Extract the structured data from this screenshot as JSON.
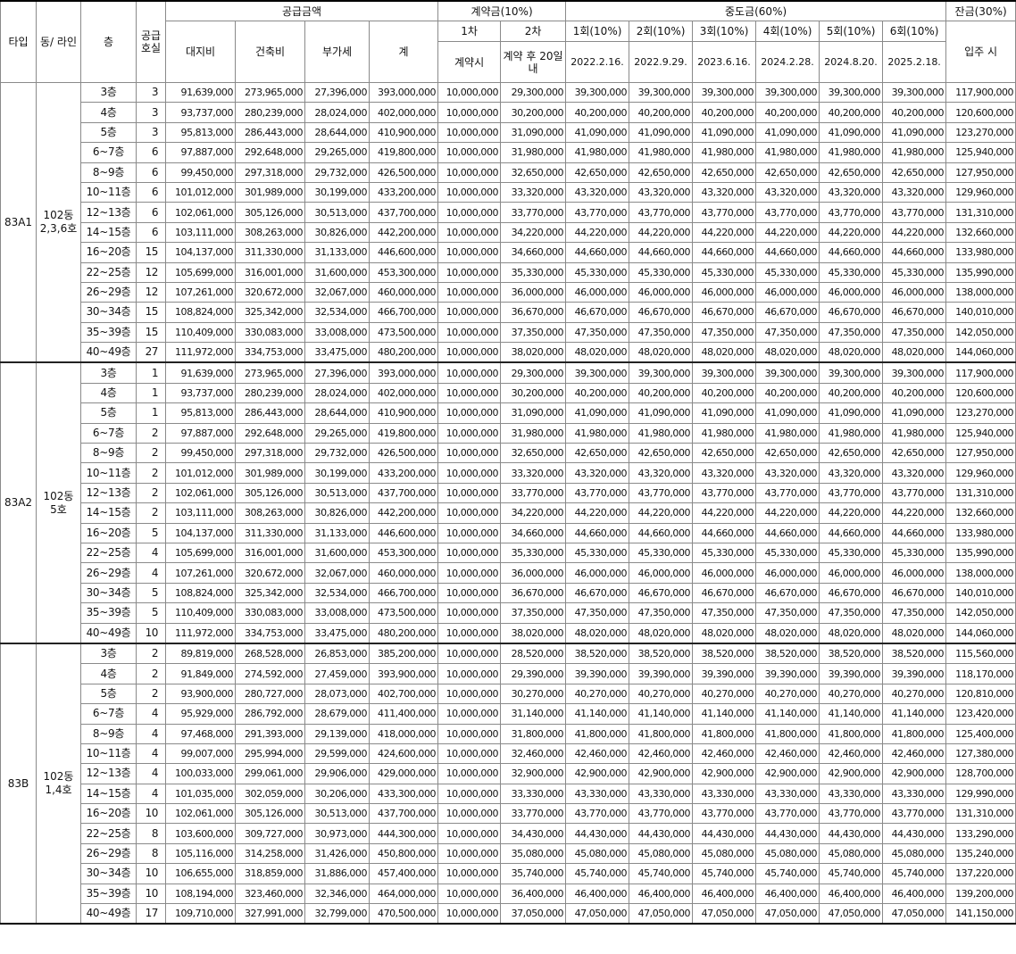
{
  "headers": {
    "type": "타입",
    "dong_line": "동/ 라인",
    "floor": "층",
    "supply_units": "공급 호실",
    "supply_amount": "공급금액",
    "land": "대지비",
    "building": "건축비",
    "vat": "부가세",
    "total": "계",
    "deposit": "계약금(10%)",
    "deposit_1": "1차",
    "deposit_2": "2차",
    "deposit_1_when": "계약시",
    "deposit_2_when": "계약 후 20일내",
    "middle": "중도금(60%)",
    "middle_rounds": [
      "1회(10%)",
      "2회(10%)",
      "3회(10%)",
      "4회(10%)",
      "5회(10%)",
      "6회(10%)"
    ],
    "middle_dates": [
      "2022.2.16.",
      "2022.9.29.",
      "2023.6.16.",
      "2024.2.28.",
      "2024.8.20.",
      "2025.2.18."
    ],
    "balance": "잔금(30%)",
    "balance_when": "입주 시"
  },
  "groups": [
    {
      "type": "83A1",
      "dong": "102동",
      "line": "2,3,6호",
      "rows": [
        {
          "floor": "3층",
          "units": "3",
          "land": "91,639,000",
          "building": "273,965,000",
          "vat": "27,396,000",
          "total": "393,000,000",
          "dep1": "10,000,000",
          "dep2": "29,300,000",
          "mid": "39,300,000",
          "bal": "117,900,000"
        },
        {
          "floor": "4층",
          "units": "3",
          "land": "93,737,000",
          "building": "280,239,000",
          "vat": "28,024,000",
          "total": "402,000,000",
          "dep1": "10,000,000",
          "dep2": "30,200,000",
          "mid": "40,200,000",
          "bal": "120,600,000"
        },
        {
          "floor": "5층",
          "units": "3",
          "land": "95,813,000",
          "building": "286,443,000",
          "vat": "28,644,000",
          "total": "410,900,000",
          "dep1": "10,000,000",
          "dep2": "31,090,000",
          "mid": "41,090,000",
          "bal": "123,270,000"
        },
        {
          "floor": "6~7층",
          "units": "6",
          "land": "97,887,000",
          "building": "292,648,000",
          "vat": "29,265,000",
          "total": "419,800,000",
          "dep1": "10,000,000",
          "dep2": "31,980,000",
          "mid": "41,980,000",
          "bal": "125,940,000"
        },
        {
          "floor": "8~9층",
          "units": "6",
          "land": "99,450,000",
          "building": "297,318,000",
          "vat": "29,732,000",
          "total": "426,500,000",
          "dep1": "10,000,000",
          "dep2": "32,650,000",
          "mid": "42,650,000",
          "bal": "127,950,000"
        },
        {
          "floor": "10~11층",
          "units": "6",
          "land": "101,012,000",
          "building": "301,989,000",
          "vat": "30,199,000",
          "total": "433,200,000",
          "dep1": "10,000,000",
          "dep2": "33,320,000",
          "mid": "43,320,000",
          "bal": "129,960,000"
        },
        {
          "floor": "12~13층",
          "units": "6",
          "land": "102,061,000",
          "building": "305,126,000",
          "vat": "30,513,000",
          "total": "437,700,000",
          "dep1": "10,000,000",
          "dep2": "33,770,000",
          "mid": "43,770,000",
          "bal": "131,310,000"
        },
        {
          "floor": "14~15층",
          "units": "6",
          "land": "103,111,000",
          "building": "308,263,000",
          "vat": "30,826,000",
          "total": "442,200,000",
          "dep1": "10,000,000",
          "dep2": "34,220,000",
          "mid": "44,220,000",
          "bal": "132,660,000"
        },
        {
          "floor": "16~20층",
          "units": "15",
          "land": "104,137,000",
          "building": "311,330,000",
          "vat": "31,133,000",
          "total": "446,600,000",
          "dep1": "10,000,000",
          "dep2": "34,660,000",
          "mid": "44,660,000",
          "bal": "133,980,000"
        },
        {
          "floor": "22~25층",
          "units": "12",
          "land": "105,699,000",
          "building": "316,001,000",
          "vat": "31,600,000",
          "total": "453,300,000",
          "dep1": "10,000,000",
          "dep2": "35,330,000",
          "mid": "45,330,000",
          "bal": "135,990,000"
        },
        {
          "floor": "26~29층",
          "units": "12",
          "land": "107,261,000",
          "building": "320,672,000",
          "vat": "32,067,000",
          "total": "460,000,000",
          "dep1": "10,000,000",
          "dep2": "36,000,000",
          "mid": "46,000,000",
          "bal": "138,000,000"
        },
        {
          "floor": "30~34층",
          "units": "15",
          "land": "108,824,000",
          "building": "325,342,000",
          "vat": "32,534,000",
          "total": "466,700,000",
          "dep1": "10,000,000",
          "dep2": "36,670,000",
          "mid": "46,670,000",
          "bal": "140,010,000"
        },
        {
          "floor": "35~39층",
          "units": "15",
          "land": "110,409,000",
          "building": "330,083,000",
          "vat": "33,008,000",
          "total": "473,500,000",
          "dep1": "10,000,000",
          "dep2": "37,350,000",
          "mid": "47,350,000",
          "bal": "142,050,000"
        },
        {
          "floor": "40~49층",
          "units": "27",
          "land": "111,972,000",
          "building": "334,753,000",
          "vat": "33,475,000",
          "total": "480,200,000",
          "dep1": "10,000,000",
          "dep2": "38,020,000",
          "mid": "48,020,000",
          "bal": "144,060,000"
        }
      ]
    },
    {
      "type": "83A2",
      "dong": "102동",
      "line": "5호",
      "rows": [
        {
          "floor": "3층",
          "units": "1",
          "land": "91,639,000",
          "building": "273,965,000",
          "vat": "27,396,000",
          "total": "393,000,000",
          "dep1": "10,000,000",
          "dep2": "29,300,000",
          "mid": "39,300,000",
          "bal": "117,900,000"
        },
        {
          "floor": "4층",
          "units": "1",
          "land": "93,737,000",
          "building": "280,239,000",
          "vat": "28,024,000",
          "total": "402,000,000",
          "dep1": "10,000,000",
          "dep2": "30,200,000",
          "mid": "40,200,000",
          "bal": "120,600,000"
        },
        {
          "floor": "5층",
          "units": "1",
          "land": "95,813,000",
          "building": "286,443,000",
          "vat": "28,644,000",
          "total": "410,900,000",
          "dep1": "10,000,000",
          "dep2": "31,090,000",
          "mid": "41,090,000",
          "bal": "123,270,000"
        },
        {
          "floor": "6~7층",
          "units": "2",
          "land": "97,887,000",
          "building": "292,648,000",
          "vat": "29,265,000",
          "total": "419,800,000",
          "dep1": "10,000,000",
          "dep2": "31,980,000",
          "mid": "41,980,000",
          "bal": "125,940,000"
        },
        {
          "floor": "8~9층",
          "units": "2",
          "land": "99,450,000",
          "building": "297,318,000",
          "vat": "29,732,000",
          "total": "426,500,000",
          "dep1": "10,000,000",
          "dep2": "32,650,000",
          "mid": "42,650,000",
          "bal": "127,950,000"
        },
        {
          "floor": "10~11층",
          "units": "2",
          "land": "101,012,000",
          "building": "301,989,000",
          "vat": "30,199,000",
          "total": "433,200,000",
          "dep1": "10,000,000",
          "dep2": "33,320,000",
          "mid": "43,320,000",
          "bal": "129,960,000"
        },
        {
          "floor": "12~13층",
          "units": "2",
          "land": "102,061,000",
          "building": "305,126,000",
          "vat": "30,513,000",
          "total": "437,700,000",
          "dep1": "10,000,000",
          "dep2": "33,770,000",
          "mid": "43,770,000",
          "bal": "131,310,000"
        },
        {
          "floor": "14~15층",
          "units": "2",
          "land": "103,111,000",
          "building": "308,263,000",
          "vat": "30,826,000",
          "total": "442,200,000",
          "dep1": "10,000,000",
          "dep2": "34,220,000",
          "mid": "44,220,000",
          "bal": "132,660,000"
        },
        {
          "floor": "16~20층",
          "units": "5",
          "land": "104,137,000",
          "building": "311,330,000",
          "vat": "31,133,000",
          "total": "446,600,000",
          "dep1": "10,000,000",
          "dep2": "34,660,000",
          "mid": "44,660,000",
          "bal": "133,980,000"
        },
        {
          "floor": "22~25층",
          "units": "4",
          "land": "105,699,000",
          "building": "316,001,000",
          "vat": "31,600,000",
          "total": "453,300,000",
          "dep1": "10,000,000",
          "dep2": "35,330,000",
          "mid": "45,330,000",
          "bal": "135,990,000"
        },
        {
          "floor": "26~29층",
          "units": "4",
          "land": "107,261,000",
          "building": "320,672,000",
          "vat": "32,067,000",
          "total": "460,000,000",
          "dep1": "10,000,000",
          "dep2": "36,000,000",
          "mid": "46,000,000",
          "bal": "138,000,000"
        },
        {
          "floor": "30~34층",
          "units": "5",
          "land": "108,824,000",
          "building": "325,342,000",
          "vat": "32,534,000",
          "total": "466,700,000",
          "dep1": "10,000,000",
          "dep2": "36,670,000",
          "mid": "46,670,000",
          "bal": "140,010,000"
        },
        {
          "floor": "35~39층",
          "units": "5",
          "land": "110,409,000",
          "building": "330,083,000",
          "vat": "33,008,000",
          "total": "473,500,000",
          "dep1": "10,000,000",
          "dep2": "37,350,000",
          "mid": "47,350,000",
          "bal": "142,050,000"
        },
        {
          "floor": "40~49층",
          "units": "10",
          "land": "111,972,000",
          "building": "334,753,000",
          "vat": "33,475,000",
          "total": "480,200,000",
          "dep1": "10,000,000",
          "dep2": "38,020,000",
          "mid": "48,020,000",
          "bal": "144,060,000"
        }
      ]
    },
    {
      "type": "83B",
      "dong": "102동",
      "line": "1,4호",
      "rows": [
        {
          "floor": "3층",
          "units": "2",
          "land": "89,819,000",
          "building": "268,528,000",
          "vat": "26,853,000",
          "total": "385,200,000",
          "dep1": "10,000,000",
          "dep2": "28,520,000",
          "mid": "38,520,000",
          "bal": "115,560,000"
        },
        {
          "floor": "4층",
          "units": "2",
          "land": "91,849,000",
          "building": "274,592,000",
          "vat": "27,459,000",
          "total": "393,900,000",
          "dep1": "10,000,000",
          "dep2": "29,390,000",
          "mid": "39,390,000",
          "bal": "118,170,000"
        },
        {
          "floor": "5층",
          "units": "2",
          "land": "93,900,000",
          "building": "280,727,000",
          "vat": "28,073,000",
          "total": "402,700,000",
          "dep1": "10,000,000",
          "dep2": "30,270,000",
          "mid": "40,270,000",
          "bal": "120,810,000"
        },
        {
          "floor": "6~7층",
          "units": "4",
          "land": "95,929,000",
          "building": "286,792,000",
          "vat": "28,679,000",
          "total": "411,400,000",
          "dep1": "10,000,000",
          "dep2": "31,140,000",
          "mid": "41,140,000",
          "bal": "123,420,000"
        },
        {
          "floor": "8~9층",
          "units": "4",
          "land": "97,468,000",
          "building": "291,393,000",
          "vat": "29,139,000",
          "total": "418,000,000",
          "dep1": "10,000,000",
          "dep2": "31,800,000",
          "mid": "41,800,000",
          "bal": "125,400,000"
        },
        {
          "floor": "10~11층",
          "units": "4",
          "land": "99,007,000",
          "building": "295,994,000",
          "vat": "29,599,000",
          "total": "424,600,000",
          "dep1": "10,000,000",
          "dep2": "32,460,000",
          "mid": "42,460,000",
          "bal": "127,380,000"
        },
        {
          "floor": "12~13층",
          "units": "4",
          "land": "100,033,000",
          "building": "299,061,000",
          "vat": "29,906,000",
          "total": "429,000,000",
          "dep1": "10,000,000",
          "dep2": "32,900,000",
          "mid": "42,900,000",
          "bal": "128,700,000"
        },
        {
          "floor": "14~15층",
          "units": "4",
          "land": "101,035,000",
          "building": "302,059,000",
          "vat": "30,206,000",
          "total": "433,300,000",
          "dep1": "10,000,000",
          "dep2": "33,330,000",
          "mid": "43,330,000",
          "bal": "129,990,000"
        },
        {
          "floor": "16~20층",
          "units": "10",
          "land": "102,061,000",
          "building": "305,126,000",
          "vat": "30,513,000",
          "total": "437,700,000",
          "dep1": "10,000,000",
          "dep2": "33,770,000",
          "mid": "43,770,000",
          "bal": "131,310,000"
        },
        {
          "floor": "22~25층",
          "units": "8",
          "land": "103,600,000",
          "building": "309,727,000",
          "vat": "30,973,000",
          "total": "444,300,000",
          "dep1": "10,000,000",
          "dep2": "34,430,000",
          "mid": "44,430,000",
          "bal": "133,290,000"
        },
        {
          "floor": "26~29층",
          "units": "8",
          "land": "105,116,000",
          "building": "314,258,000",
          "vat": "31,426,000",
          "total": "450,800,000",
          "dep1": "10,000,000",
          "dep2": "35,080,000",
          "mid": "45,080,000",
          "bal": "135,240,000"
        },
        {
          "floor": "30~34층",
          "units": "10",
          "land": "106,655,000",
          "building": "318,859,000",
          "vat": "31,886,000",
          "total": "457,400,000",
          "dep1": "10,000,000",
          "dep2": "35,740,000",
          "mid": "45,740,000",
          "bal": "137,220,000"
        },
        {
          "floor": "35~39층",
          "units": "10",
          "land": "108,194,000",
          "building": "323,460,000",
          "vat": "32,346,000",
          "total": "464,000,000",
          "dep1": "10,000,000",
          "dep2": "36,400,000",
          "mid": "46,400,000",
          "bal": "139,200,000"
        },
        {
          "floor": "40~49층",
          "units": "17",
          "land": "109,710,000",
          "building": "327,991,000",
          "vat": "32,799,000",
          "total": "470,500,000",
          "dep1": "10,000,000",
          "dep2": "37,050,000",
          "mid": "47,050,000",
          "bal": "141,150,000"
        }
      ]
    }
  ]
}
